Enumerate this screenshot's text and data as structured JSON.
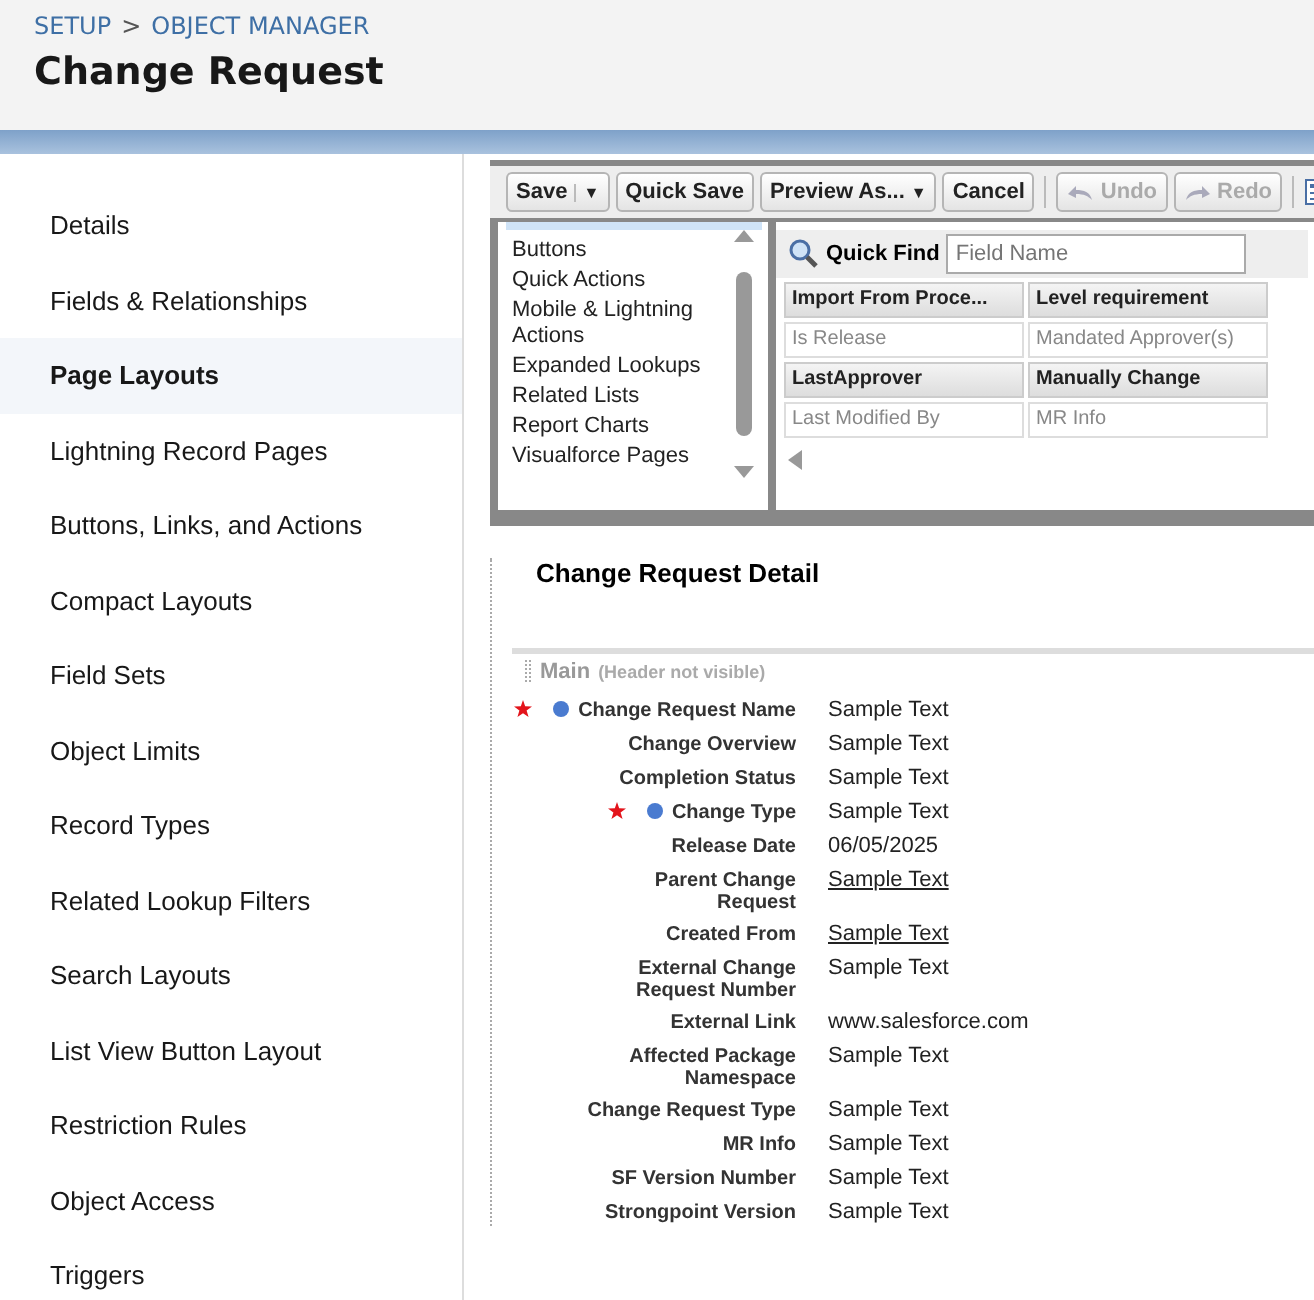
{
  "breadcrumb": {
    "items": [
      "SETUP",
      "OBJECT MANAGER"
    ],
    "separator": ">"
  },
  "title": "Change Request",
  "sidebar": {
    "items": [
      {
        "label": "Details",
        "selected": false
      },
      {
        "label": "Fields & Relationships",
        "selected": false
      },
      {
        "label": "Page Layouts",
        "selected": true
      },
      {
        "label": "Lightning Record Pages",
        "selected": false
      },
      {
        "label": "Buttons, Links, and Actions",
        "selected": false
      },
      {
        "label": "Compact Layouts",
        "selected": false
      },
      {
        "label": "Field Sets",
        "selected": false
      },
      {
        "label": "Object Limits",
        "selected": false
      },
      {
        "label": "Record Types",
        "selected": false
      },
      {
        "label": "Related Lookup Filters",
        "selected": false
      },
      {
        "label": "Search Layouts",
        "selected": false
      },
      {
        "label": "List View Button Layout",
        "selected": false
      },
      {
        "label": "Restriction Rules",
        "selected": false
      },
      {
        "label": "Object Access",
        "selected": false
      },
      {
        "label": "Triggers",
        "selected": false
      }
    ]
  },
  "toolbar": {
    "buttons": [
      {
        "label": "Save",
        "caret": "▼",
        "disabled": false,
        "kind": "split"
      },
      {
        "label": "Quick Save",
        "disabled": false,
        "kind": "plain"
      },
      {
        "label": "Preview As...",
        "caret": "▼",
        "disabled": false,
        "kind": "menu"
      },
      {
        "label": "Cancel",
        "disabled": false,
        "kind": "plain"
      },
      {
        "label": "Undo",
        "disabled": true,
        "kind": "undo"
      },
      {
        "label": "Redo",
        "disabled": true,
        "kind": "redo"
      }
    ]
  },
  "palette": {
    "categories": [
      {
        "label": "Buttons"
      },
      {
        "label": "Quick Actions"
      },
      {
        "label": "Mobile & Lightning Actions"
      },
      {
        "label": "Expanded Lookups"
      },
      {
        "label": "Related Lists"
      },
      {
        "label": "Report Charts"
      },
      {
        "label": "Visualforce Pages"
      }
    ],
    "quick_find": {
      "label": "Quick Find",
      "placeholder": "Field Name"
    },
    "fields": [
      {
        "label": "Import From Proce...",
        "used": false
      },
      {
        "label": "Level requirement",
        "used": false
      },
      {
        "label": "Is Release",
        "used": true
      },
      {
        "label": "Mandated Approver(s)",
        "used": true
      },
      {
        "label": "LastApprover",
        "used": false
      },
      {
        "label": "Manually Change",
        "used": false
      },
      {
        "label": "Last Modified By",
        "used": true
      },
      {
        "label": "MR Info",
        "used": true
      }
    ]
  },
  "detail": {
    "title": "Change Request Detail",
    "section": {
      "name": "Main",
      "note": "(Header not visible)"
    },
    "fields": [
      {
        "label": "Change Request Name",
        "value": "Sample Text",
        "required": true,
        "link": false
      },
      {
        "label": "Change Overview",
        "value": "Sample Text",
        "required": false,
        "link": false
      },
      {
        "label": "Completion Status",
        "value": "Sample Text",
        "required": false,
        "link": false
      },
      {
        "label": "Change Type",
        "value": "Sample Text",
        "required": true,
        "link": false
      },
      {
        "label": "Release Date",
        "value": "06/05/2025",
        "required": false,
        "link": false
      },
      {
        "label": "Parent Change Request",
        "value": "Sample Text",
        "required": false,
        "link": true
      },
      {
        "label": "Created From",
        "value": "Sample Text",
        "required": false,
        "link": true
      },
      {
        "label": "External Change Request Number",
        "value": "Sample Text",
        "required": false,
        "link": false
      },
      {
        "label": "External Link",
        "value": "www.salesforce.com",
        "required": false,
        "link": false
      },
      {
        "label": "Affected Package Namespace",
        "value": "Sample Text",
        "required": false,
        "link": false
      },
      {
        "label": "Change Request Type",
        "value": "Sample Text",
        "required": false,
        "link": false
      },
      {
        "label": "MR Info",
        "value": "Sample Text",
        "required": false,
        "link": false
      },
      {
        "label": "SF Version Number",
        "value": "Sample Text",
        "required": false,
        "link": false
      },
      {
        "label": "Strongpoint Version",
        "value": "Sample Text",
        "required": false,
        "link": false
      }
    ]
  }
}
